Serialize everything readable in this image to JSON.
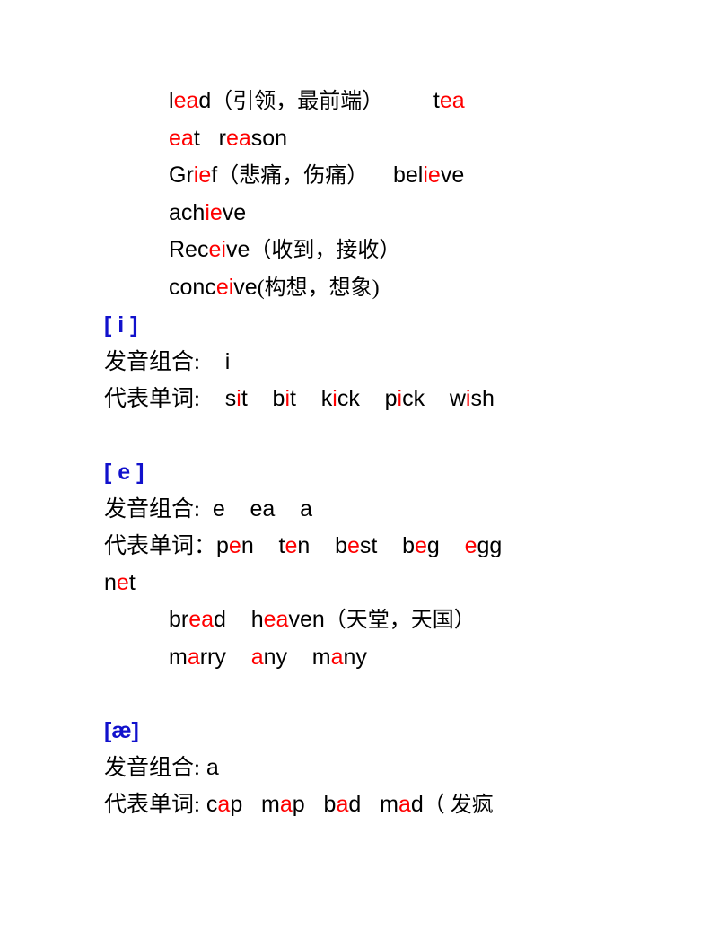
{
  "document": {
    "title": "English Vowel Pronunciation Notes",
    "colors": {
      "highlight": "#FF0000",
      "heading": "#1111CC",
      "text": "#000000",
      "background": "#FFFFFF"
    }
  },
  "intro_lines": [
    {
      "id": "line-lead",
      "indent": "deep",
      "segments": [
        {
          "text": "l",
          "color": "black"
        },
        {
          "text": "ea",
          "color": "red"
        },
        {
          "text": "d",
          "color": "black"
        },
        {
          "text": "（引领，最前端）",
          "color": "black",
          "script": "cn"
        },
        {
          "text": "        ",
          "color": "black"
        },
        {
          "text": "t",
          "color": "black"
        },
        {
          "text": "ea",
          "color": "red"
        }
      ]
    },
    {
      "id": "line-eat-reason",
      "indent": "normal",
      "segments": [
        {
          "text": "ea",
          "color": "red"
        },
        {
          "text": "t",
          "color": "black"
        },
        {
          "text": "   ",
          "color": "black"
        },
        {
          "text": "r",
          "color": "black"
        },
        {
          "text": "ea",
          "color": "red"
        },
        {
          "text": "son",
          "color": "black"
        }
      ]
    },
    {
      "id": "line-grief-believe",
      "indent": "normal",
      "segments": [
        {
          "text": "Gr",
          "color": "black"
        },
        {
          "text": "ie",
          "color": "red"
        },
        {
          "text": "f",
          "color": "black"
        },
        {
          "text": "（悲痛，伤痛）",
          "color": "black",
          "script": "cn"
        },
        {
          "text": "    ",
          "color": "black"
        },
        {
          "text": "bel",
          "color": "black"
        },
        {
          "text": "ie",
          "color": "red"
        },
        {
          "text": "ve",
          "color": "black"
        }
      ]
    },
    {
      "id": "line-achieve",
      "indent": "normal",
      "segments": [
        {
          "text": "ach",
          "color": "black"
        },
        {
          "text": "ie",
          "color": "red"
        },
        {
          "text": "ve",
          "color": "black"
        }
      ]
    },
    {
      "id": "line-receive",
      "indent": "normal",
      "segments": [
        {
          "text": "Rec",
          "color": "black"
        },
        {
          "text": "ei",
          "color": "red"
        },
        {
          "text": "ve",
          "color": "black"
        },
        {
          "text": "（收到，接收）",
          "color": "black",
          "script": "cn"
        }
      ]
    },
    {
      "id": "line-conceive",
      "indent": "normal",
      "segments": [
        {
          "text": "conc",
          "color": "black"
        },
        {
          "text": "ei",
          "color": "red"
        },
        {
          "text": "ve",
          "color": "black"
        },
        {
          "text": "(构想，想象)",
          "color": "black",
          "script": "cn"
        }
      ]
    }
  ],
  "sections": [
    {
      "id": "section-i",
      "phoneme": "[ i ]",
      "combo_label": "发音组合:",
      "combo_value": "    i",
      "words_label": "代表单词:",
      "words_lines": [
        {
          "id": "words-i-1",
          "segments": [
            {
              "text": "    s",
              "color": "black"
            },
            {
              "text": "i",
              "color": "red"
            },
            {
              "text": "t",
              "color": "black"
            },
            {
              "text": "    b",
              "color": "black"
            },
            {
              "text": "i",
              "color": "red"
            },
            {
              "text": "t",
              "color": "black"
            },
            {
              "text": "    k",
              "color": "black"
            },
            {
              "text": "i",
              "color": "red"
            },
            {
              "text": "ck",
              "color": "black"
            },
            {
              "text": "    p",
              "color": "black"
            },
            {
              "text": "i",
              "color": "red"
            },
            {
              "text": "ck",
              "color": "black"
            },
            {
              "text": "    w",
              "color": "black"
            },
            {
              "text": "i",
              "color": "red"
            },
            {
              "text": "sh",
              "color": "black"
            }
          ]
        }
      ],
      "extra_lines": []
    },
    {
      "id": "section-e",
      "phoneme": "[ e ]",
      "combo_label": "发音组合:",
      "combo_value": "  e    ea    a",
      "words_label": "代表单词：",
      "words_lines": [
        {
          "id": "words-e-1",
          "segments": [
            {
              "text": "p",
              "color": "black"
            },
            {
              "text": "e",
              "color": "red"
            },
            {
              "text": "n",
              "color": "black"
            },
            {
              "text": "    t",
              "color": "black"
            },
            {
              "text": "e",
              "color": "red"
            },
            {
              "text": "n",
              "color": "black"
            },
            {
              "text": "    b",
              "color": "black"
            },
            {
              "text": "e",
              "color": "red"
            },
            {
              "text": "st",
              "color": "black"
            },
            {
              "text": "    b",
              "color": "black"
            },
            {
              "text": "e",
              "color": "red"
            },
            {
              "text": "g",
              "color": "black"
            },
            {
              "text": "    ",
              "color": "black"
            },
            {
              "text": "e",
              "color": "red"
            },
            {
              "text": "gg",
              "color": "black"
            }
          ]
        },
        {
          "id": "words-e-2",
          "segments": [
            {
              "text": "n",
              "color": "black"
            },
            {
              "text": "e",
              "color": "red"
            },
            {
              "text": "t",
              "color": "black"
            }
          ]
        }
      ],
      "extra_lines": [
        {
          "id": "line-bread-heaven",
          "indent": "normal",
          "segments": [
            {
              "text": "br",
              "color": "black"
            },
            {
              "text": "ea",
              "color": "red"
            },
            {
              "text": "d",
              "color": "black"
            },
            {
              "text": "    h",
              "color": "black"
            },
            {
              "text": "ea",
              "color": "red"
            },
            {
              "text": "ven",
              "color": "black"
            },
            {
              "text": "（天堂，天国）",
              "color": "black",
              "script": "cn"
            }
          ]
        },
        {
          "id": "line-marry-any-many",
          "indent": "normal",
          "segments": [
            {
              "text": "m",
              "color": "black"
            },
            {
              "text": "a",
              "color": "red"
            },
            {
              "text": "rry",
              "color": "black"
            },
            {
              "text": "    ",
              "color": "black"
            },
            {
              "text": "a",
              "color": "red"
            },
            {
              "text": "ny",
              "color": "black"
            },
            {
              "text": "    m",
              "color": "black"
            },
            {
              "text": "a",
              "color": "red"
            },
            {
              "text": "ny",
              "color": "black"
            }
          ]
        }
      ]
    },
    {
      "id": "section-ae",
      "phoneme": "[æ]",
      "combo_label": "发音组合:",
      "combo_value": " a",
      "words_label": "代表单词:",
      "words_lines": [
        {
          "id": "words-ae-1",
          "segments": [
            {
              "text": " c",
              "color": "black"
            },
            {
              "text": "a",
              "color": "red"
            },
            {
              "text": "p",
              "color": "black"
            },
            {
              "text": "   m",
              "color": "black"
            },
            {
              "text": "a",
              "color": "red"
            },
            {
              "text": "p",
              "color": "black"
            },
            {
              "text": "   b",
              "color": "black"
            },
            {
              "text": "a",
              "color": "red"
            },
            {
              "text": "d",
              "color": "black"
            },
            {
              "text": "   m",
              "color": "black"
            },
            {
              "text": "a",
              "color": "red"
            },
            {
              "text": "d",
              "color": "black"
            },
            {
              "text": "（ 发疯",
              "color": "black",
              "script": "cn"
            }
          ]
        }
      ],
      "extra_lines": []
    }
  ]
}
